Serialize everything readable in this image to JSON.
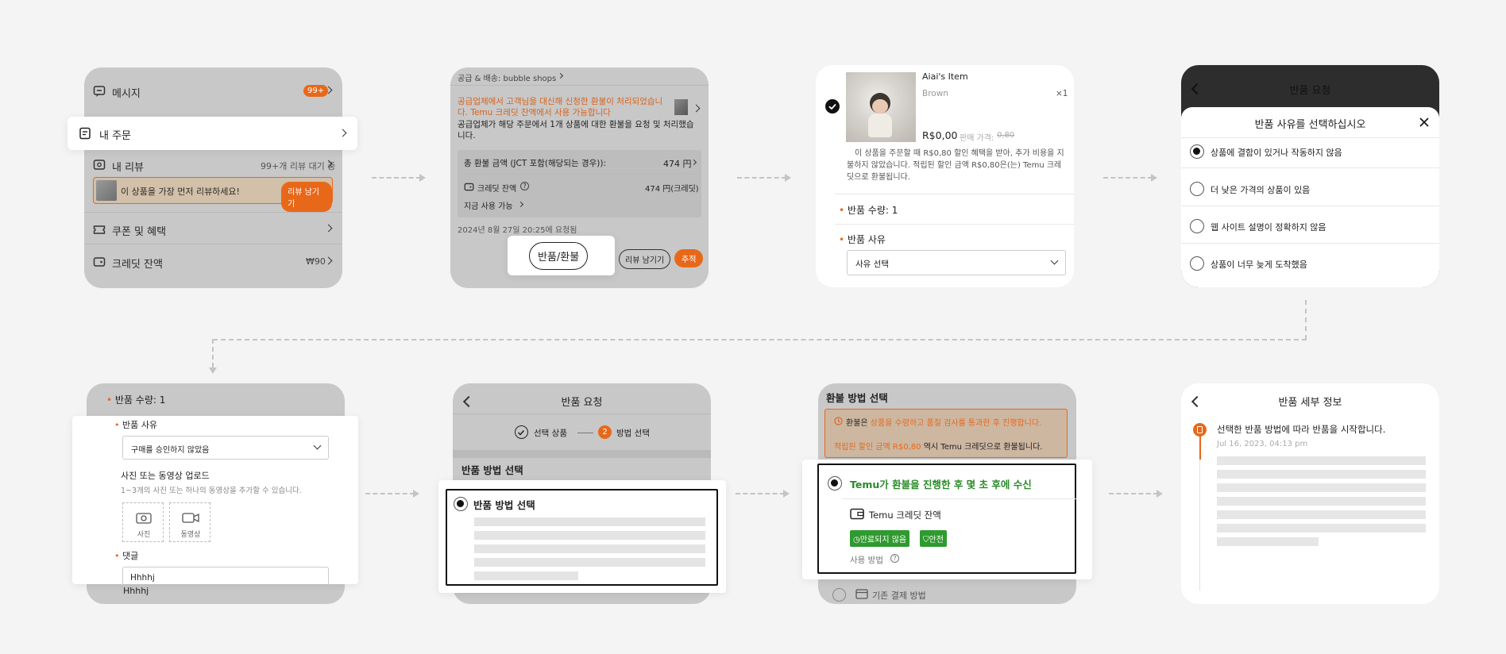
{
  "screen1": {
    "message_label": "메시지",
    "message_badge": "99+",
    "my_orders_label": "내 주문",
    "my_reviews_label": "내 리뷰",
    "my_reviews_status": "99+개 리뷰 대기 중",
    "review_prompt": "이 상품을 가장 먼저 리뷰하세요!",
    "review_button": "리뷰 남기기",
    "coupons_label": "쿠폰 및 혜택",
    "credit_label": "크레딧 잔액",
    "credit_value": "₩90"
  },
  "screen2": {
    "supplier_line": "공급 & 배송: bubble shops",
    "notice_orange": "공급업체에서 고객님을 대신해 신청한 환불이 처리되었습니다. Temu 크레딧 잔액에서 사용 가능합니다",
    "notice_dark": "공급업체가 해당 주문에서 1개 상품에 대한 환불을 요청 및 처리했습니다.",
    "total_refund_label": "총 환불 금액 (JCT 포함(해당되는 경우)):",
    "total_refund_value": "474 円",
    "credit_label": "크레딧 잔액",
    "credit_value": "474 円(크레딧)",
    "use_now": "지금 사용 가능",
    "requested_at": "2024년 8월 27일 20:25에 요청됨",
    "return_button": "반품/환불",
    "review_button": "리뷰 남기기",
    "track_button": "추적"
  },
  "screen3": {
    "item_name": "Aiai's Item",
    "item_color": "Brown",
    "item_qty": "×1",
    "price": "R$0,00",
    "sale_price_label": "판매 가격:",
    "sale_price": "0,80",
    "note": "이 상품을 주문할 때 R$0,80 할인 혜택을 받아, 추가 비용을 지불하지 않았습니다. 적립된 할인 금액 R$0,80은(는) Temu 크레딧으로 환불됩니다.",
    "return_qty_label": "반품 수량: 1",
    "return_reason_label": "반품 사유",
    "reason_select_placeholder": "사유 선택"
  },
  "screen4": {
    "header_title": "반품 요청",
    "sheet_title": "반품 사유를 선택하십시오",
    "options": [
      "상품에 결함이 있거나 작동하지 않음",
      "더 낮은 가격의 상품이 있음",
      "웹 사이트 설명이 정확하지 않음",
      "상품이 너무 늦게 도착했음"
    ]
  },
  "screen5": {
    "return_qty_label": "반품 수량: 1",
    "return_reason_label": "반품 사유",
    "reason_value": "구매를 승인하지 않았음",
    "upload_title": "사진 또는 동영상 업로드",
    "upload_hint": "1~3개의 사진 또는 하나의 동영상을 추가할 수 있습니다.",
    "photo_label": "사진",
    "video_label": "동영상",
    "comment_label": "댓글",
    "comment_value": "Hhhhj"
  },
  "screen6": {
    "header_title": "반품 요청",
    "step1": "선택 상품",
    "step2_num": "2",
    "step2": "방법 선택",
    "section_title": "반품 방법 선택",
    "popup_title": "반품 방법 선택"
  },
  "screen7": {
    "title": "환불 방법 선택",
    "info1_prefix": "환불은",
    "info1_orange": "상품을 수령하고 품질 검사를 통과한 후 진행합니다.",
    "info2_orange": "적립된 할인 금액 R$0,80",
    "info2_suffix": "역시 Temu 크레딧으로 환불됩니다.",
    "option_title": "Temu가 환불을 진행한 후 몇 초 후에 수신",
    "credit_label": "Temu 크레딧 잔액",
    "tag1": "만료되지 않음",
    "tag2": "안전",
    "usage_label": "사용 방법",
    "original_method": "기존 결제 방법"
  },
  "screen8": {
    "header_title": "반품 세부 정보",
    "event_title": "선택한 반품 방법에 따라 반품을 시작합니다.",
    "event_time": "Jul 16, 2023, 04:13 pm"
  }
}
